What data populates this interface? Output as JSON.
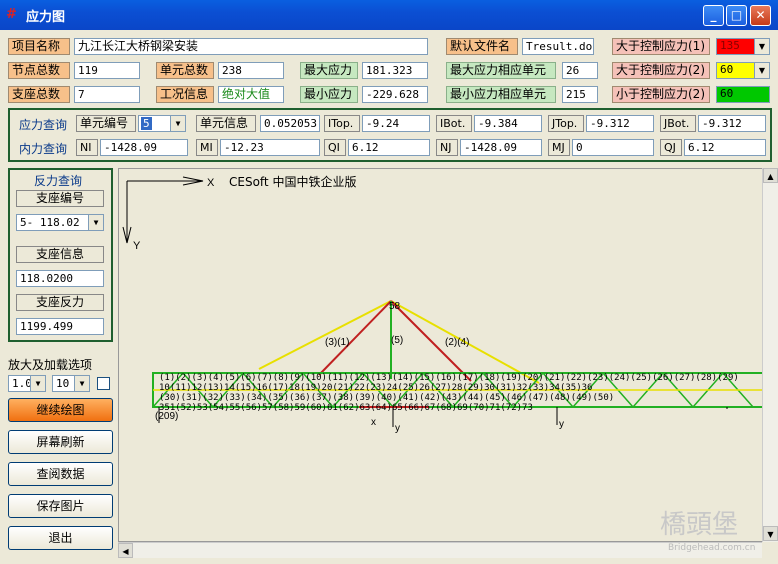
{
  "window": {
    "title": "应力图",
    "icon": "stress-chart-app-icon"
  },
  "project": {
    "name_label": "项目名称",
    "name_value": "九江长江大桥钢梁安装",
    "default_file_label": "默认文件名",
    "default_file_value": "Tresult.doc",
    "node_count_label": "节点总数",
    "node_count_value": "119",
    "element_count_label": "单元总数",
    "element_count_value": "238",
    "support_count_label": "支座总数",
    "support_count_value": "7",
    "case_info_label": "工况信息",
    "case_info_value": "绝对大值",
    "max_stress_label": "最大应力",
    "max_stress_value": "181.323",
    "min_stress_label": "最小应力",
    "min_stress_value": "-229.628",
    "max_elem_label": "最大应力相应单元",
    "max_elem_value": "26",
    "min_elem_label": "最小应力相应单元",
    "min_elem_value": "215",
    "ctrl1_label": "大于控制应力(1)",
    "ctrl1_value": "135",
    "ctrl1_color": "#ff0000",
    "ctrl2_label": "大于控制应力(2)",
    "ctrl2_value": "60",
    "ctrl2_color": "#ffff00",
    "ctrl3_label": "小于控制应力(2)",
    "ctrl3_value": "60",
    "ctrl3_color": "#00c800"
  },
  "stress_query": {
    "label": "应力查询",
    "elem_no_label": "单元编号",
    "elem_no_value": "5",
    "elem_info_label": "单元信息",
    "elem_info_value": "0.052053",
    "itop_label": "ITop.",
    "itop_value": "-9.24",
    "ibot_label": "IBot.",
    "ibot_value": "-9.384",
    "jtop_label": "JTop.",
    "jtop_value": "-9.312",
    "jbot_label": "JBot.",
    "jbot_value": "-9.312"
  },
  "force_query": {
    "label": "内力查询",
    "ni_label": "NI",
    "ni_value": "-1428.09",
    "mi_label": "MI",
    "mi_value": "-12.23",
    "qi_label": "QI",
    "qi_value": "6.12",
    "nj_label": "NJ",
    "nj_value": "-1428.09",
    "mj_label": "MJ",
    "mj_value": "0",
    "qj_label": "QJ",
    "qj_value": "6.12"
  },
  "reaction": {
    "title": "反力查询",
    "support_no_label": "支座编号",
    "support_no_value": "5- 118.02",
    "support_info_label": "支座信息",
    "support_info_value": "118.0200",
    "support_force_label": "支座反力",
    "support_force_value": "1199.499"
  },
  "zoom": {
    "label": "放大及加载选项",
    "scale_value": "1.0",
    "load_value": "10"
  },
  "buttons": {
    "continue": "继续绘图",
    "refresh": "屏幕刷新",
    "view_data": "查阅数据",
    "save_image": "保存图片",
    "exit": "退出"
  },
  "canvas": {
    "x_axis": "X",
    "y_axis": "Y",
    "credit": "CESoft 中国中铁企业版",
    "labels": {
      "top_node": "58",
      "member_a": "(3)(1)",
      "member_b": "(5)",
      "member_c": "(2)(4)",
      "left_label": "(209)",
      "bottom_x": "x",
      "bottom_y": "y",
      "right_y": "y"
    }
  },
  "watermark": {
    "main": "橋頭堡",
    "sub": "Bridgehead.com.cn"
  }
}
